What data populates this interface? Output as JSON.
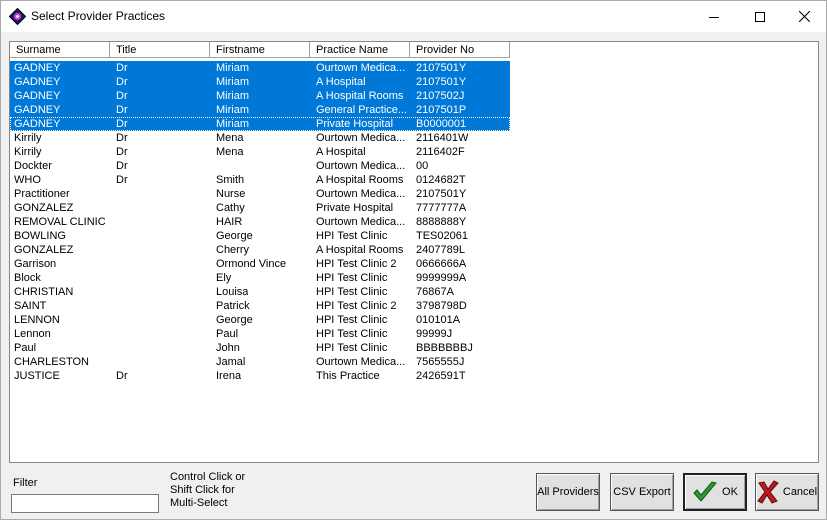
{
  "window": {
    "title": "Select Provider Practices"
  },
  "columns": [
    "Surname",
    "Title",
    "Firstname",
    "Practice Name",
    "Provider No"
  ],
  "rows": [
    {
      "surname": "GADNEY",
      "title": "Dr",
      "firstname": "Miriam",
      "practice": "Ourtown Medica...",
      "provider": "2107501Y",
      "selected": true
    },
    {
      "surname": "GADNEY",
      "title": "Dr",
      "firstname": "Miriam",
      "practice": "A Hospital",
      "provider": "2107501Y",
      "selected": true
    },
    {
      "surname": "GADNEY",
      "title": "Dr",
      "firstname": "Miriam",
      "practice": "A Hospital Rooms",
      "provider": "2107502J",
      "selected": true
    },
    {
      "surname": "GADNEY",
      "title": "Dr",
      "firstname": "Miriam",
      "practice": "General Practice...",
      "provider": "2107501P",
      "selected": true
    },
    {
      "surname": "GADNEY",
      "title": "Dr",
      "firstname": "Miriam",
      "practice": "Private Hospital",
      "provider": "B0000001",
      "selected": true,
      "focused": true
    },
    {
      "surname": "Kirrily",
      "title": "Dr",
      "firstname": "Mena",
      "practice": "Ourtown Medica...",
      "provider": "2116401W"
    },
    {
      "surname": "Kirrily",
      "title": "Dr",
      "firstname": "Mena",
      "practice": "A Hospital",
      "provider": "2116402F"
    },
    {
      "surname": "Dockter",
      "title": "Dr",
      "firstname": "",
      "practice": "Ourtown Medica...",
      "provider": "00"
    },
    {
      "surname": "WHO",
      "title": "Dr",
      "firstname": "Smith",
      "practice": "A Hospital Rooms",
      "provider": "0124682T"
    },
    {
      "surname": "Practitioner",
      "title": "",
      "firstname": "Nurse",
      "practice": "Ourtown Medica...",
      "provider": "2107501Y"
    },
    {
      "surname": "GONZALEZ",
      "title": "",
      "firstname": "Cathy",
      "practice": "Private Hospital",
      "provider": "7777777A"
    },
    {
      "surname": "REMOVAL CLINIC",
      "title": "",
      "firstname": "HAIR",
      "practice": "Ourtown Medica...",
      "provider": "8888888Y"
    },
    {
      "surname": "BOWLING",
      "title": "",
      "firstname": "George",
      "practice": "HPI Test Clinic",
      "provider": "TES02061"
    },
    {
      "surname": "GONZALEZ",
      "title": "",
      "firstname": "Cherry",
      "practice": "A Hospital Rooms",
      "provider": "2407789L"
    },
    {
      "surname": "Garrison",
      "title": "",
      "firstname": "Ormond Vince",
      "practice": "HPI Test Clinic 2",
      "provider": "0666666A"
    },
    {
      "surname": "Block",
      "title": "",
      "firstname": "Ely",
      "practice": "HPI Test Clinic",
      "provider": "9999999A"
    },
    {
      "surname": "CHRISTIAN",
      "title": "",
      "firstname": "Louisa",
      "practice": "HPI Test Clinic",
      "provider": "76867A"
    },
    {
      "surname": "SAINT",
      "title": "",
      "firstname": "Patrick",
      "practice": "HPI Test Clinic 2",
      "provider": "3798798D"
    },
    {
      "surname": "LENNON",
      "title": "",
      "firstname": "George",
      "practice": "HPI Test Clinic",
      "provider": "010101A"
    },
    {
      "surname": "Lennon",
      "title": "",
      "firstname": "Paul",
      "practice": "HPI Test Clinic",
      "provider": "99999J"
    },
    {
      "surname": "Paul",
      "title": "",
      "firstname": "John",
      "practice": "HPI Test Clinic",
      "provider": "BBBBBBBJ"
    },
    {
      "surname": "CHARLESTON",
      "title": "",
      "firstname": "Jamal",
      "practice": "Ourtown Medica...",
      "provider": "7565555J"
    },
    {
      "surname": "JUSTICE",
      "title": "Dr",
      "firstname": "Irena",
      "practice": "This Practice",
      "provider": "2426591T"
    }
  ],
  "filter": {
    "label": "Filter",
    "value": ""
  },
  "hint": [
    "Control Click or",
    "Shift Click for",
    "Multi-Select"
  ],
  "buttons": {
    "all_providers": "All Providers",
    "csv_export": "CSV Export",
    "ok": "OK",
    "cancel": "Cancel"
  },
  "colors": {
    "selection": "#0078d7",
    "ok_check": "#2e9b2e",
    "cancel_x": "#c0181e"
  }
}
